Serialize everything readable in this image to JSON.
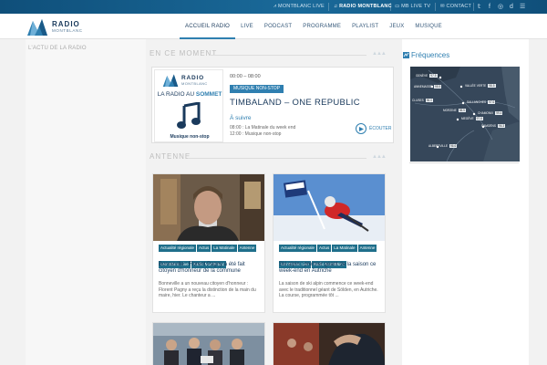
{
  "topbar": {
    "montblanc_live": "MONTBLANC LIVE",
    "radio_montblanc": "RADIO MONTBLANC",
    "mb_live_tv": "MB LIVE TV",
    "contact": "CONTACT"
  },
  "header": {
    "logo_word": "RADIO",
    "logo_sub": "MONTBLANC",
    "nav": [
      "ACCUEIL RADIO",
      "LIVE",
      "PODCAST",
      "PROGRAMME",
      "PLAYLIST",
      "JEUX",
      "MUSIQUE"
    ]
  },
  "left": {
    "title": "L'ACTU DE LA RADIO"
  },
  "now": {
    "section": "EN CE MOMENT",
    "thumb_logo_word": "RADIO",
    "thumb_logo_sub": "MONTBLANC",
    "thumb_tagline_1": "LA RADIO AU",
    "thumb_tagline_2": "SOMMET",
    "thumb_caption": "Musique non-stop",
    "time": "00:00 – 08:00",
    "badge": "MUSIQUE NON-STOP",
    "title": "TIMBALAND – ONE REPUBLIC",
    "next_label": "À suivre",
    "next": [
      "08:00 : La Matinale du week end",
      "12:00 : Musique non-stop"
    ],
    "listen": "ÉCOUTER"
  },
  "antenne": {
    "section": "ANTENNE"
  },
  "frequences": {
    "title": "Fréquences",
    "map_labels": [
      {
        "name": "GENÈVE",
        "freq": "97.5"
      },
      {
        "name": "ANNEMASSE",
        "freq": "95.5"
      },
      {
        "name": "VALLÉE VERTE",
        "freq": "98.5"
      },
      {
        "name": "CLUSES",
        "freq": "96.0"
      },
      {
        "name": "SALLANCHES",
        "freq": "97.6"
      },
      {
        "name": "CHAMONIX",
        "freq": "99.4"
      },
      {
        "name": "MEGÈVE",
        "freq": "97.8"
      },
      {
        "name": "ALBERTVILLE",
        "freq": "96.6"
      },
      {
        "name": "SAMOËNS",
        "freq": "96.3"
      },
      {
        "name": "MORZINE",
        "freq": "98.9"
      }
    ]
  },
  "articles": [
    {
      "tags": [
        "Actualité régionale",
        "Actus",
        "La Matinale",
        "Antenne",
        "MontBlanc Live",
        "Radio MontBlanc"
      ],
      "title": "Bonneville : Florent Pagny a été fait citoyen d'honneur de la commune",
      "body": "Bonneville a un nouveau citoyen d'honneur : Florent Pagny a reçu la distinction de la main du maire, hier. Le chanteur a ..."
    },
    {
      "tags": [
        "Actualité régionale",
        "Actus",
        "La Matinale",
        "Antenne",
        "MontBlanc Live",
        "Radio MontBlanc"
      ],
      "title": "Ski alpin : premier géant de la saison ce week-end en Autriche",
      "body": "La saison de ski alpin commence ce week-end avec le traditionnel géant de Sölden, en Autriche. La course, programmée tôt ..."
    }
  ],
  "colors": {
    "accent": "#2f7fb0",
    "navy": "#1a3a5c",
    "tag": "#1f6f8b",
    "topbar": "#0f4f7a"
  }
}
